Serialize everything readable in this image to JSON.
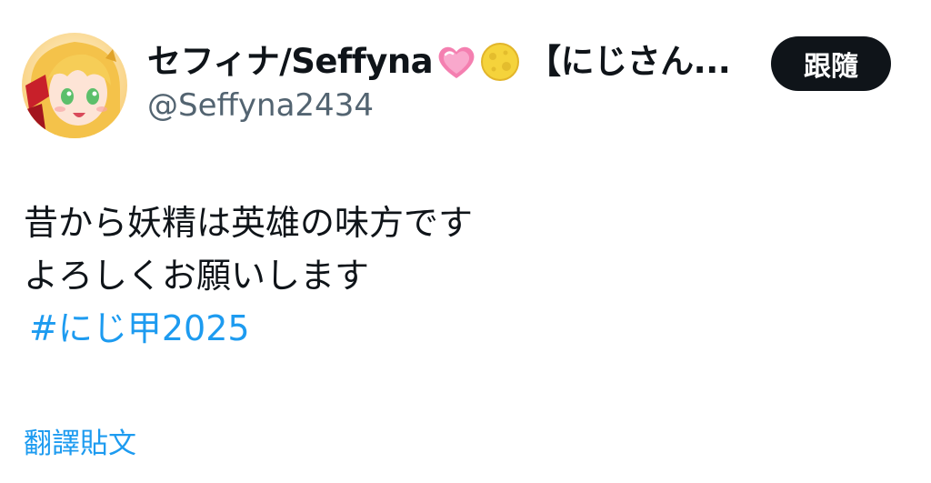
{
  "header": {
    "avatar_icon": "user-avatar-anime-girl",
    "display_name": "セフィナ/Seffyna",
    "emojis": [
      "pink-heart-emoji",
      "full-moon-emoji"
    ],
    "name_suffix": "【にじさん...",
    "handle": "@Seffyna2434",
    "follow_label": "跟隨"
  },
  "tweet": {
    "lines": [
      "昔から妖精は英雄の味方です",
      "よろしくお願いします"
    ],
    "hashtag": "#にじ甲2025"
  },
  "translate_label": "翻譯貼文",
  "colors": {
    "text": "#0f1419",
    "secondary_text": "#536471",
    "link": "#1d9bf0",
    "button_bg": "#0f1419",
    "button_text": "#ffffff"
  }
}
